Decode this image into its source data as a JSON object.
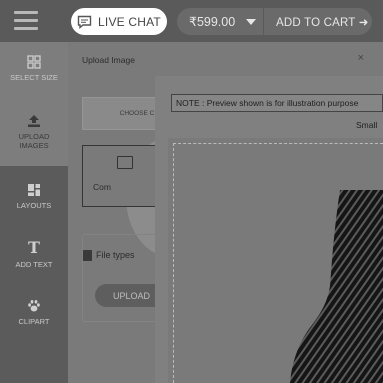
{
  "topbar": {
    "live_chat_label": "LIVE CHAT",
    "price": "₹599.00",
    "add_to_cart_label": "ADD TO CART ➜"
  },
  "sidebar": {
    "items": [
      {
        "label": "SELECT SIZE",
        "icon": "grid-icon",
        "active": true
      },
      {
        "label": "UPLOAD IMAGES",
        "icon": "upload-icon",
        "active": false
      },
      {
        "label": "LAYOUTS",
        "icon": "layout-icon",
        "active": false
      },
      {
        "label": "ADD TEXT",
        "icon": "text-icon",
        "active": false
      },
      {
        "label": "CLIPART",
        "icon": "paw-icon",
        "active": false
      }
    ]
  },
  "upload_panel": {
    "title": "Upload Image",
    "choose_label": "CHOOSE C",
    "computer_label": "Com",
    "file_types_label": "File types",
    "upload_button_label": "UPLOAD",
    "close_symbol": "×"
  },
  "preview": {
    "note": "NOTE : Preview shown is for illustration purpose",
    "size_label": "Small"
  },
  "colors": {
    "overlay": "#6f6f6f",
    "live_chat_bg": "#ffffff"
  }
}
